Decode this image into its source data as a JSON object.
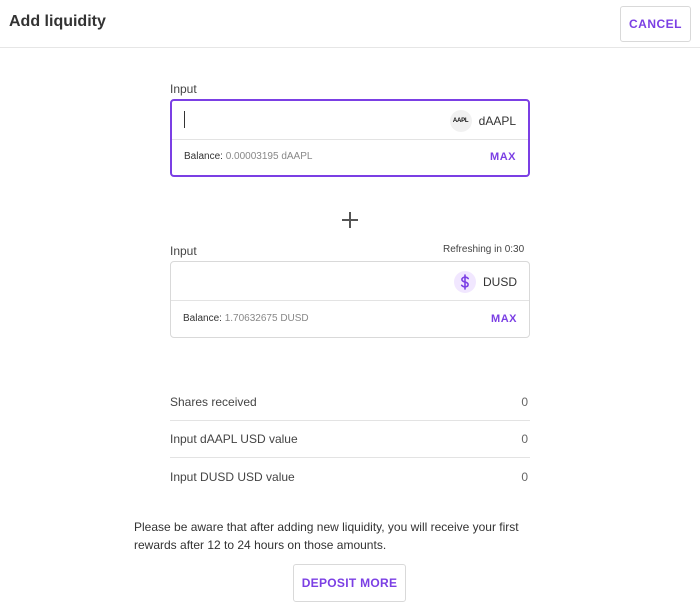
{
  "header": {
    "title": "Add liquidity",
    "cancel_label": "CANCEL"
  },
  "input_a": {
    "label": "Input",
    "value": "",
    "token_symbol": "dAAPL",
    "token_logo_text": "AAPL",
    "balance_label": "Balance:",
    "balance_value": "0.00003195 dAAPL",
    "max_label": "MAX"
  },
  "input_b": {
    "label": "Input",
    "refresh_text": "Refreshing in 0:30",
    "value": "",
    "token_symbol": "DUSD",
    "balance_label": "Balance:",
    "balance_value": "1.70632675 DUSD",
    "max_label": "MAX"
  },
  "summary": [
    {
      "label": "Shares received",
      "value": "0"
    },
    {
      "label": "Input dAAPL USD value",
      "value": "0"
    },
    {
      "label": "Input DUSD USD value",
      "value": "0"
    }
  ],
  "notice": "Please be aware that after adding new liquidity, you will receive your first rewards after 12 to 24 hours on those amounts.",
  "deposit_label": "DEPOSIT MORE",
  "icons": {
    "plus": "plus-icon",
    "dusd": "dollar-icon"
  },
  "colors": {
    "accent": "#7b3fe4",
    "dusd_badge_bg": "#f1e7ff"
  }
}
